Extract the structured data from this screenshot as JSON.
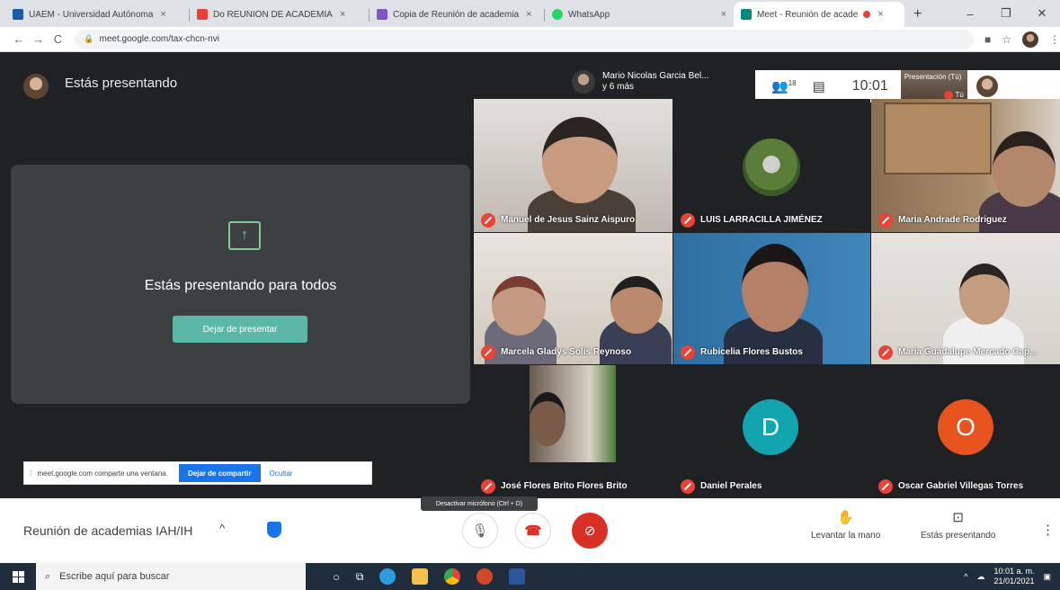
{
  "browser": {
    "tabs": [
      {
        "title": "UAEM - Universidad Autónoma",
        "favicon_color": "#1a5aa8"
      },
      {
        "title": "Do REUNIÓN DE ACADEMIA",
        "favicon_color": "#ea4335"
      },
      {
        "title": "Copia de Reunión de academia",
        "favicon_color": "#7e57c2"
      },
      {
        "title": "WhatsApp",
        "favicon_color": "#25d366"
      },
      {
        "title": "Meet - Reunión de acade",
        "favicon_color": "#00897b"
      }
    ],
    "url": "meet.google.com/tax-chcn-nvi"
  },
  "meet": {
    "presenting_header": "Estás presentando",
    "active_speaker": {
      "line1": "Mario Nicolas Garcia Bel...",
      "line2": "y 6 más"
    },
    "participants_count": "18",
    "time": "10:01",
    "self_preview": {
      "label": "Presentación (Tú)",
      "you": "Tú"
    },
    "present_panel": {
      "message": "Estás presentando para todos",
      "stop_button": "Dejar de presentar"
    },
    "share_bar": {
      "text": "meet.google.com comparte una ventana.",
      "stop_button": "Dejar de compartir",
      "hide": "Ocultar"
    },
    "participants": [
      {
        "name": "Manuel de Jesus Sainz Aispuro"
      },
      {
        "name": "LUIS LARRACILLA JIMÉNEZ"
      },
      {
        "name": "Maria Andrade Rodriguez"
      },
      {
        "name": "Marcela Gladys Solis Reynoso"
      },
      {
        "name": "Rubicelia Flores Bustos"
      },
      {
        "name": "Maria Guadalupe Mercado Cap..."
      },
      {
        "name": "José Flores Brito Flores Brito"
      },
      {
        "name": "Daniel Perales",
        "initial": "D",
        "color": "#12a4af"
      },
      {
        "name": "Oscar Gabriel Villegas Torres",
        "initial": "O",
        "color": "#e8541e"
      }
    ],
    "bottom": {
      "meeting_name": "Reunión de academias IAH/IH",
      "mic_tooltip": "Desactivar micrófono (Ctrl + D)",
      "raise_hand": "Levantar la mano",
      "presenting": "Estás presentando"
    }
  },
  "taskbar": {
    "search_placeholder": "Escribe aquí para buscar",
    "time": "10:01 a. m.",
    "date": "21/01/2021"
  }
}
